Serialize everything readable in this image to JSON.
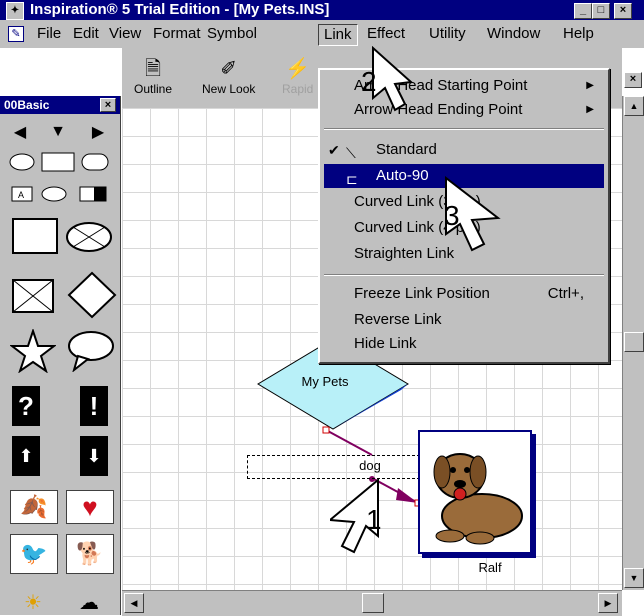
{
  "window": {
    "title": "Inspiration® 5 Trial Edition - [My Pets.INS]",
    "controls": [
      "_",
      "□",
      "×"
    ]
  },
  "menubar": {
    "items": [
      "File",
      "Edit",
      "View",
      "Format",
      "Symbol",
      "Link",
      "Effect",
      "Utility",
      "Window",
      "Help"
    ],
    "active": "Link"
  },
  "toolbar": {
    "tools": [
      "Outline",
      "New Look",
      "Rapid"
    ]
  },
  "palette": {
    "title": "00Basic"
  },
  "link_menu": {
    "items": [
      {
        "label": "Arrow Head Starting Point",
        "submenu": true
      },
      {
        "label": "Arrow Head Ending Point",
        "submenu": true
      },
      {
        "label": "Standard",
        "checked": true
      },
      {
        "label": "Auto-90",
        "highlighted": true
      },
      {
        "label": "Curved Link (3 pts)"
      },
      {
        "label": "Curved Link (4 pts)"
      },
      {
        "label": "Straighten Link"
      },
      {
        "label": "Freeze Link Position",
        "shortcut": "Ctrl+,"
      },
      {
        "label": "Reverse Link"
      },
      {
        "label": "Hide Link"
      }
    ]
  },
  "diagram": {
    "main_topic": "My Pets",
    "link_label": "dog",
    "pet_label": "Ralf"
  },
  "callouts": [
    "1",
    "2",
    "3"
  ],
  "colors": {
    "titlebar": "#000080",
    "diamond_fill": "#b8f0f8",
    "diamond_edge": "#1040d0",
    "link": "#800060",
    "highlight": "#000080"
  }
}
